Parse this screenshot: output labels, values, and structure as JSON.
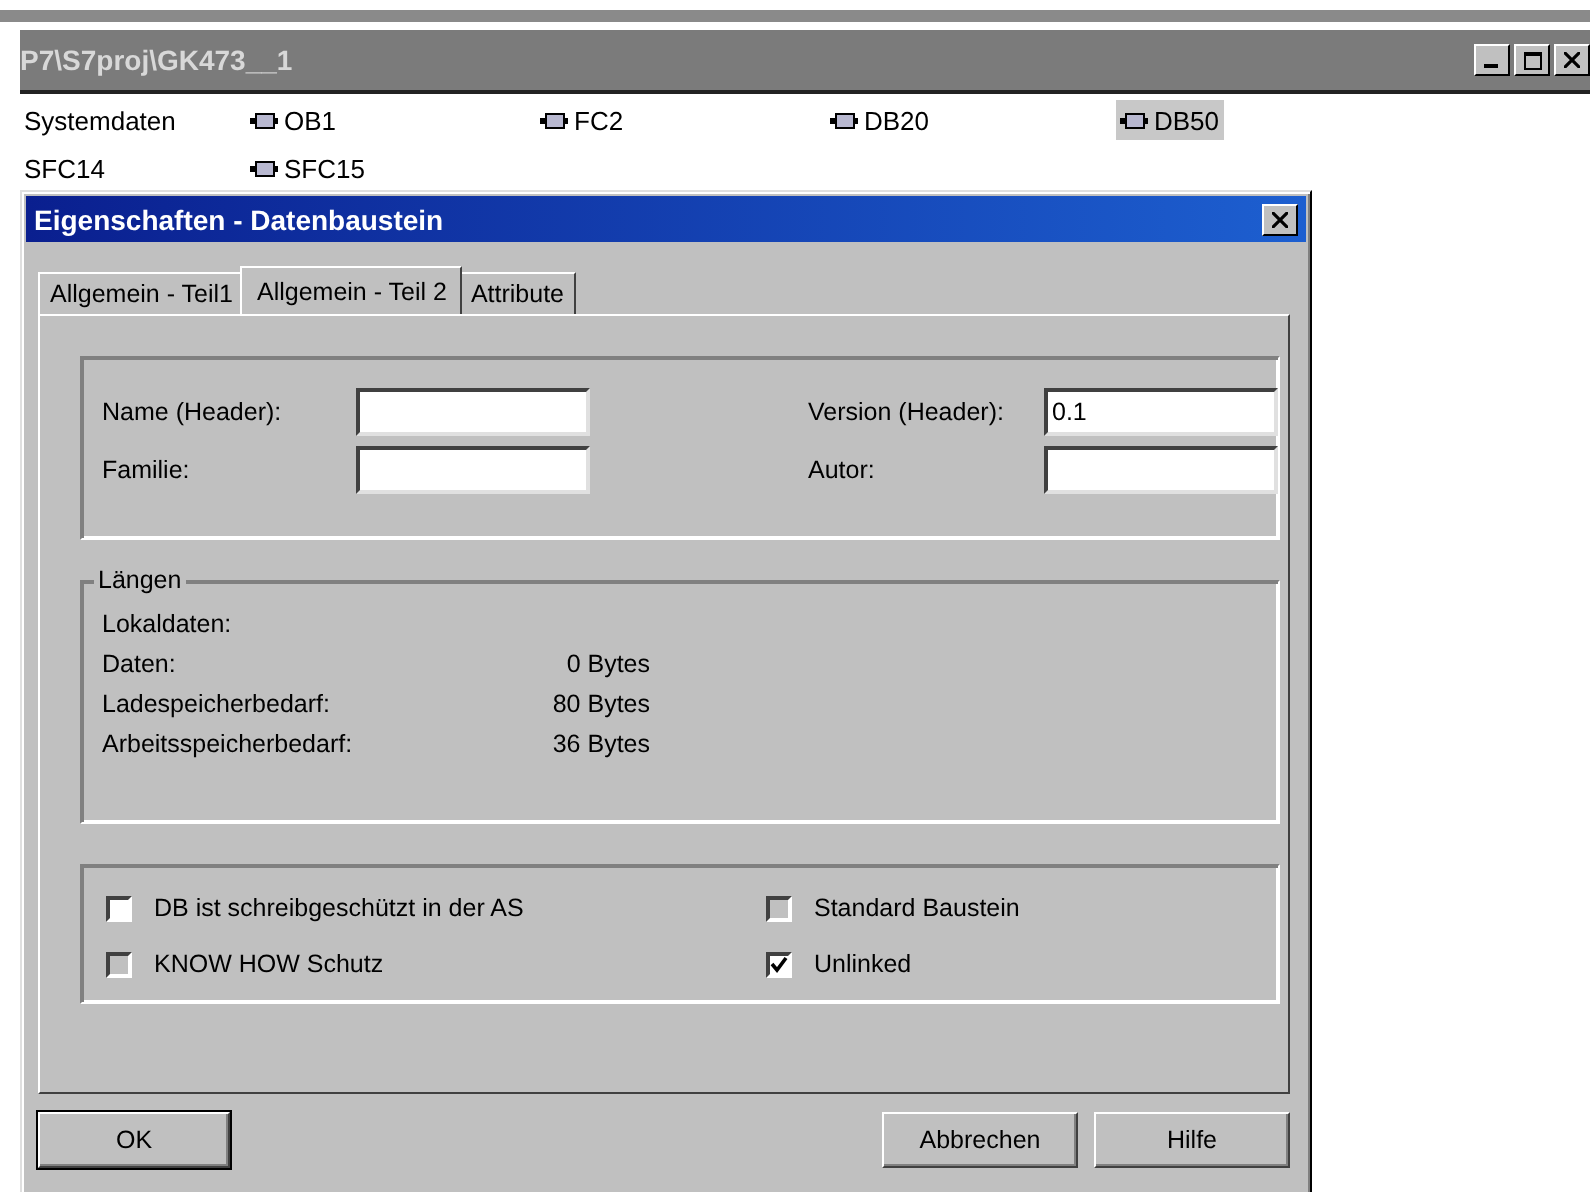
{
  "window": {
    "title": "P7\\S7proj\\GK473__1",
    "controls": [
      {
        "kind": "minimize"
      },
      {
        "kind": "maximize"
      },
      {
        "kind": "close"
      }
    ]
  },
  "objects": [
    {
      "label": "Systemdaten",
      "kind": "folder",
      "selected": false
    },
    {
      "label": "OB1",
      "kind": "block",
      "selected": false
    },
    {
      "label": "FC2",
      "kind": "block",
      "selected": false
    },
    {
      "label": "DB20",
      "kind": "block",
      "selected": false
    },
    {
      "label": "DB50",
      "kind": "block",
      "selected": true
    },
    {
      "label": "SFC14",
      "kind": "folder",
      "selected": false
    },
    {
      "label": "SFC15",
      "kind": "block",
      "selected": false
    }
  ],
  "dialog": {
    "title": "Eigenschaften - Datenbaustein",
    "tabs": [
      {
        "label": "Allgemein - Teil1",
        "selected": false
      },
      {
        "label": "Allgemein - Teil 2",
        "selected": true
      },
      {
        "label": "Attribute",
        "selected": false
      }
    ],
    "fields": [
      {
        "label": "Name (Header):"
      },
      {
        "label": "Version (Header):",
        "value": "0.1"
      },
      {
        "label": "Familie:"
      },
      {
        "label": "Autor:"
      }
    ],
    "lengths": {
      "title": "Längen",
      "rows": [
        {
          "label": "Lokaldaten:"
        },
        {
          "label": "Daten:",
          "value": "0 Bytes"
        },
        {
          "label": "Ladespeicherbedarf:",
          "value": "80 Bytes"
        },
        {
          "label": "Arbeitsspeicherbedarf:",
          "value": "36 Bytes"
        }
      ]
    },
    "options": [
      {
        "label": "DB ist schreibgeschützt in der AS",
        "checked": false,
        "disabled": false
      },
      {
        "label": "Standard Baustein",
        "checked": false,
        "disabled": true
      },
      {
        "label": "KNOW HOW Schutz",
        "checked": false,
        "disabled": true
      },
      {
        "label": "Unlinked",
        "checked": true,
        "disabled": false
      }
    ],
    "buttons": [
      {
        "label": "OK",
        "kind": "default"
      },
      {
        "label": "Abbrechen",
        "kind": "normal"
      },
      {
        "label": "Hilfe",
        "kind": "normal"
      }
    ]
  }
}
